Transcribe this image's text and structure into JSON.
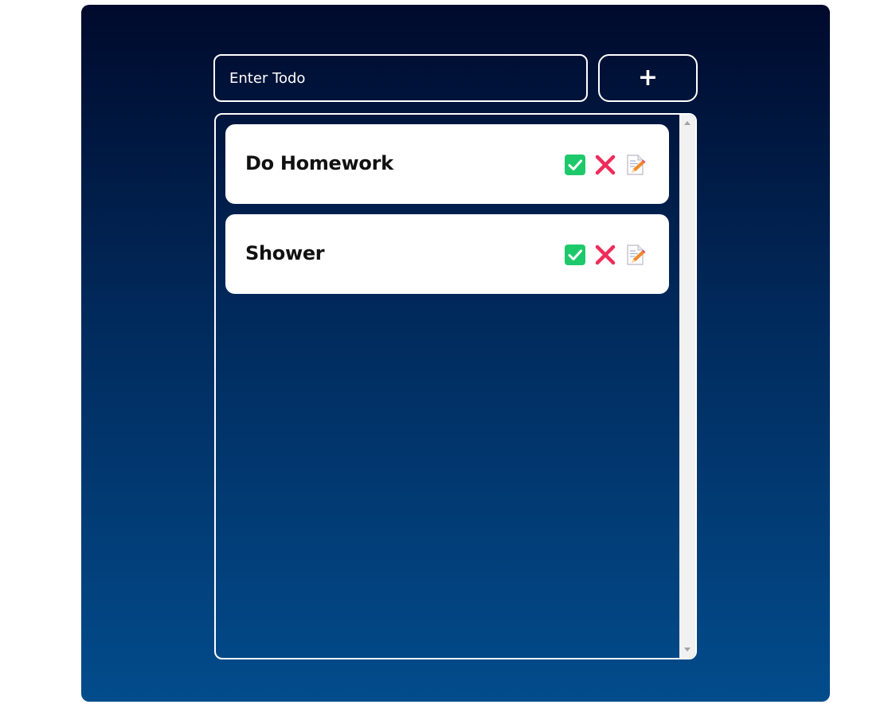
{
  "input": {
    "placeholder": "Enter Todo",
    "value": ""
  },
  "add_button": {
    "label": "+"
  },
  "todos": [
    {
      "text": "Do Homework",
      "icons": [
        "check-icon",
        "close-icon",
        "edit-icon"
      ]
    },
    {
      "text": "Shower",
      "icons": [
        "check-icon",
        "close-icon",
        "edit-icon"
      ]
    }
  ],
  "colors": {
    "gradient_top": "#000a2c",
    "gradient_bottom": "#024c8c",
    "check_green": "#1ec96b",
    "delete_red": "#ee2c5a",
    "edit_orange": "#f08a2a"
  }
}
